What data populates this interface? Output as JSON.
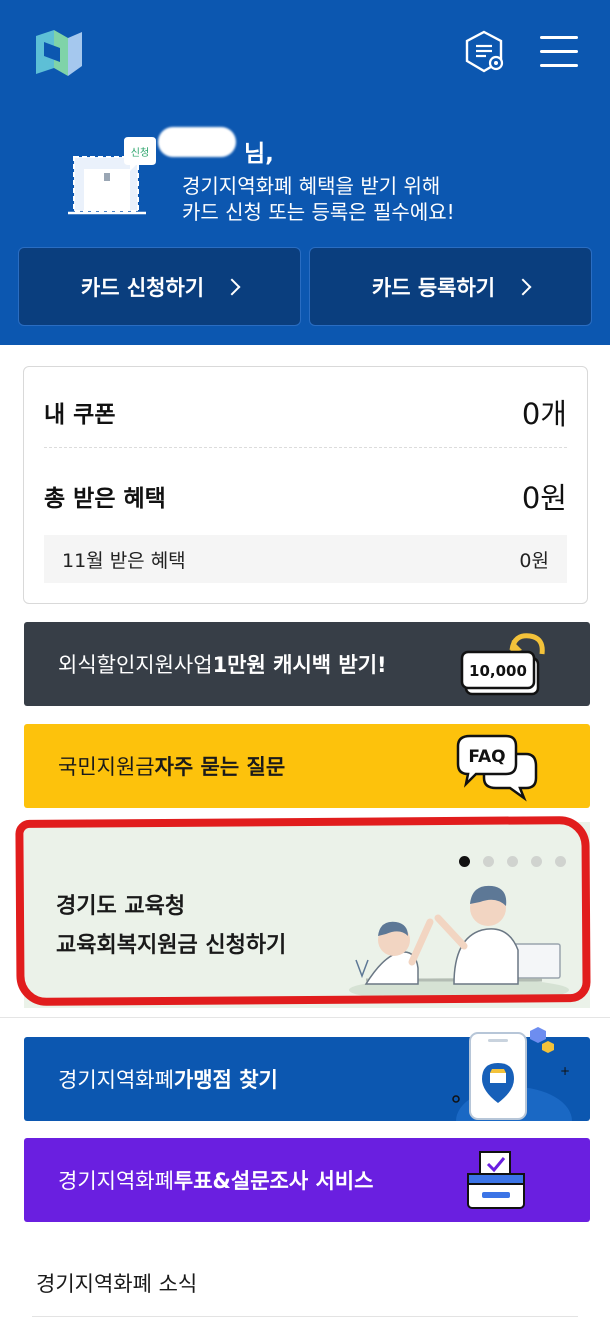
{
  "header": {
    "greeting_suffix": "님,",
    "greeting_line1": "경기지역화폐 혜택을 받기 위해",
    "greeting_line2": "카드 신청 또는 등록은 필수에요!",
    "illus_badge": "신청",
    "apply_button": "카드 신청하기",
    "register_button": "카드 등록하기"
  },
  "summary": {
    "coupon_label": "내 쿠폰",
    "coupon_value": "0개",
    "benefit_label": "총 받은 혜택",
    "benefit_value": "0원",
    "month_label": "11월 받은 혜택",
    "month_value": "0원"
  },
  "banners": {
    "cash": {
      "normal": "외식할인지원사업 ",
      "bold": "1만원 캐시백 받기!",
      "art_text": "10,000"
    },
    "faq": {
      "normal": "국민지원금 ",
      "bold": "자주 묻는 질문",
      "art_text": "FAQ"
    },
    "store": {
      "normal": "경기지역화폐 ",
      "bold": "가맹점 찾기"
    },
    "vote": {
      "normal": "경기지역화폐 ",
      "bold": "투표&설문조사 서비스"
    }
  },
  "carousel": {
    "line1": "경기도 교육청",
    "line2": "교육회복지원금 신청하기",
    "slide_count": 5,
    "active_slide": 1
  },
  "news": {
    "title": "경기지역화폐 소식"
  },
  "colors": {
    "header_blue": "#0c57b0",
    "button_navy": "#0a3e7e",
    "cash_dark": "#373e47",
    "faq_yellow": "#fdc20c",
    "vote_purple": "#6a1fe0",
    "carousel_bg": "#ebf2e9",
    "highlight_red": "#e11d1d"
  }
}
